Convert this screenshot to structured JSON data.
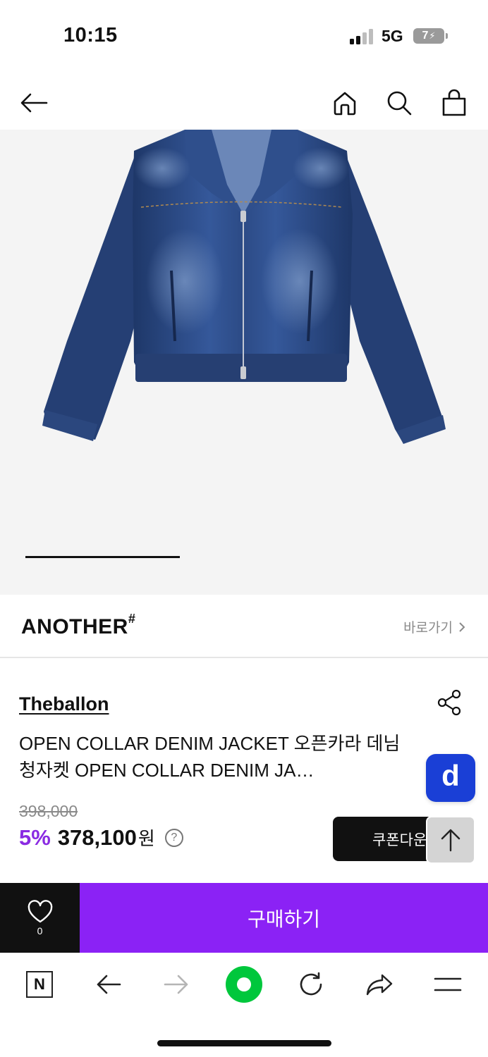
{
  "status_bar": {
    "time": "10:15",
    "network": "5G",
    "battery": "7"
  },
  "top_nav": {
    "icons": [
      "back-arrow-icon",
      "home-icon",
      "search-icon",
      "shopping-bag-icon"
    ]
  },
  "product_image": {
    "description_icon": "denim-jacket-image",
    "carousel_position": 1
  },
  "brand": {
    "logo": "ANOTHER",
    "logo_mark": "#",
    "link_label": "바로가기"
  },
  "product": {
    "seller": "Theballon",
    "title": "OPEN COLLAR DENIM JACKET 오픈카라 데님 청자켓 OPEN COLLAR DENIM JA…",
    "original_price": "398,000",
    "discount": "5%",
    "price": "378,100",
    "price_unit": "원",
    "help_mark": "?"
  },
  "actions": {
    "coupon_label": "쿠폰다운",
    "wishlist_count": "0",
    "buy_label": "구매하기",
    "floating_badge": "d"
  },
  "browser_bar": {
    "n_label": "N",
    "icons": [
      "naver-n-icon",
      "back-icon",
      "forward-icon",
      "green-dot-icon",
      "refresh-icon",
      "share-icon",
      "menu-icon"
    ]
  },
  "colors": {
    "purple": "#8b22f5",
    "discount_purple": "#8a2be2",
    "badge_blue": "#1a3fd6",
    "green": "#00c73c"
  }
}
